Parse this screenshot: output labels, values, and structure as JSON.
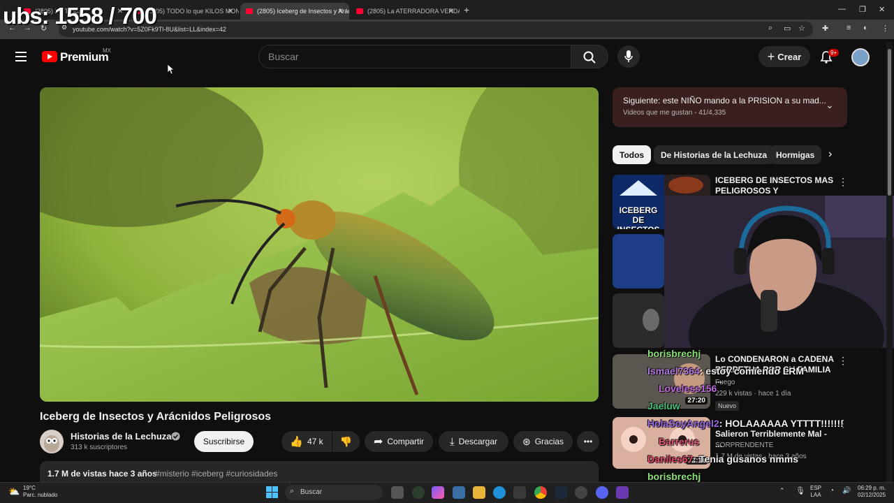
{
  "browser": {
    "tabs": [
      {
        "label": "(2805) X - Todos"
      },
      {
        "label": "(2805) TODO lo que KILOS MONS"
      },
      {
        "label": "(2805) Iceberg de Insectos y Arácnidos"
      },
      {
        "label": "(2805) La ATERRADORA VERDAD"
      }
    ],
    "url": "youtube.com/watch?v=5Z0Fk9Tl-8U&list=LL&index=42"
  },
  "overlay": {
    "subs_counter": "ubs: 1558 / 700"
  },
  "header": {
    "brand": "Premium",
    "region": "MX",
    "search_placeholder": "Buscar",
    "create_label": "Crear",
    "notif_count": "9+"
  },
  "video": {
    "title": "Iceberg de Insectos y Arácnidos Peligrosos",
    "channel": "Historias de la Lechuza",
    "subscribers": "313 k suscriptores",
    "subscribe_label": "Suscribirse",
    "likes": "47 k",
    "share_label": "Compartir",
    "download_label": "Descargar",
    "thanks_label": "Gracias",
    "views_age": "1.7 M de vistas  hace 3 años",
    "tags": "#misterio #iceberg #curiosidades"
  },
  "playlist": {
    "next_title": "Siguiente: este NIÑO mando a la PRISION a su mad...",
    "next_sub": "Videos que me gustan - 41/4,335"
  },
  "chips": [
    "Todos",
    "De Historias de la Lechuza",
    "Hormigas"
  ],
  "related": [
    {
      "title": "ICEBERG DE INSECTOS MAS PELIGROSOS Y ATERRADORE...",
      "thumb_text": "ICEBERG DE INSECTOS"
    },
    {
      "title": "Lo CONDENARON a CADENA PERPETUA POR SU FAMILIA ...",
      "channel": "Fuego",
      "meta": "229 k vistas · hace 1 día",
      "badge": "Nuevo",
      "duration": "27:20"
    },
    {
      "title": "Salieron Terriblemente Mal - ...",
      "channel": "SORPRENDENTE",
      "meta": "1.7 M de vistas · hace 3 años",
      "duration": "22:11"
    }
  ],
  "chat": [
    {
      "user": "borisbrechj",
      "msg": "",
      "color": "#8ee07a"
    },
    {
      "user": "Ismael7364",
      "msg": ": estoy comiendo LRM",
      "color": "#b07ae0"
    },
    {
      "user": "Loveless156",
      "msg": "",
      "color": "#c06ae0"
    },
    {
      "user": "Jaeluw",
      "msg": "",
      "color": "#4ac07a"
    },
    {
      "user": "HolaSoyAngel2",
      "msg": ": HOLAAAAAA YTTTT!!!!!!!",
      "color": "#9a6ae0"
    },
    {
      "user": "Barrerus",
      "msg": "",
      "color": "#e05a7a"
    },
    {
      "user": "Daniles67",
      "msg": ": Tenia gusanos nmms",
      "color": "#e04a6a"
    },
    {
      "user": "borisbrechj",
      "msg": "",
      "color": "#8ee07a"
    }
  ],
  "taskbar": {
    "temp": "19°C",
    "weather": "Parc. nublado",
    "search": "Buscar",
    "lang": "ESP",
    "layout": "LAA",
    "time": "06:29 p. m.",
    "date": "02/12/2025"
  }
}
